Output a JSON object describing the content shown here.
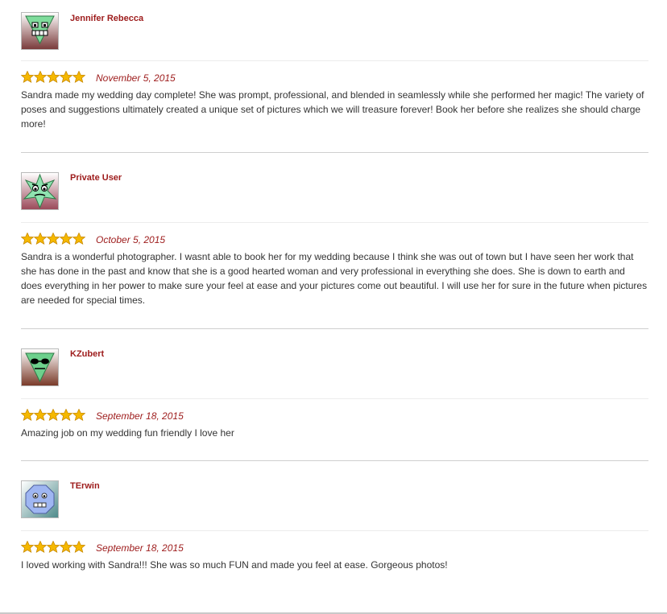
{
  "reviews": [
    {
      "name": "Jennifer Rebecca",
      "avatar_icon": "monster-avatar-icon",
      "rating": 5,
      "date": "November 5, 2015",
      "text": "Sandra made my wedding day complete! She was prompt, professional, and blended in seamlessly while she performed her magic! The variety of poses and suggestions ultimately created a unique set of pictures which we will treasure forever! Book her before she realizes she should charge more!"
    },
    {
      "name": "Private User",
      "avatar_icon": "monster-avatar-icon",
      "rating": 5,
      "date": "October 5, 2015",
      "text": "Sandra is a wonderful photographer. I wasnt able to book her for my wedding because I think she was out of town but I have seen her work that she has done in the past and know that she is a good hearted woman and very professional in everything she does. She is down to earth and does everything in her power to make sure your feel at ease and your pictures come out beautiful. I will use her for sure in the future when pictures are needed for special times."
    },
    {
      "name": "KZubert",
      "avatar_icon": "monster-avatar-icon",
      "rating": 5,
      "date": "September 18, 2015",
      "text": "Amazing job on my wedding fun friendly I love her"
    },
    {
      "name": "TErwin",
      "avatar_icon": "monster-avatar-icon",
      "rating": 5,
      "date": "September 18, 2015",
      "text": "I loved working with Sandra!!! She was so much FUN and made you feel at ease. Gorgeous photos!"
    }
  ],
  "colors": {
    "name": "#9d1b1b",
    "date": "#9d1b1b",
    "text": "#333333",
    "star": "#f5b800",
    "divider": "#cfcfcf"
  }
}
